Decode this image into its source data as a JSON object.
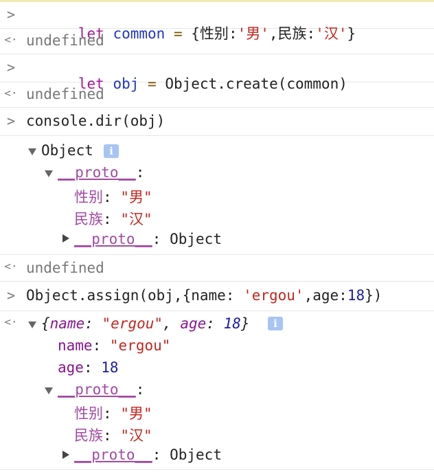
{
  "input_prompt": ">",
  "output_prompt": "<·",
  "lines": {
    "cmd1": {
      "kw": "let",
      "var": "common",
      "op": "=",
      "open": "{",
      "k1": "性别",
      "colon1": ":",
      "v1": "'男'",
      "comma": ",",
      "k2": "民族",
      "colon2": ":",
      "v2": "'汉'",
      "close": "}"
    },
    "out1": "undefined",
    "cmd2": {
      "kw": "let",
      "var": "obj",
      "op": "=",
      "rest": "Object.create(common)"
    },
    "out2": "undefined",
    "cmd3": "console.dir(obj)",
    "dir": {
      "root_label": "Object",
      "info_icon": "i",
      "proto_label": "__proto__",
      "proto_colon": ":",
      "prop1_key": "性别",
      "prop1_value": "\"男\"",
      "prop2_key": "民族",
      "prop2_value": "\"汉\"",
      "proto2_label": "__proto__",
      "proto2_colon": ":",
      "proto2_value": "Object",
      "colon_sep": ":"
    },
    "out3": "undefined",
    "cmd4": {
      "fn": "Object.assign(obj,{name: ",
      "str": "'ergou'",
      "mid": ",age:",
      "num": "18",
      "end": "})"
    },
    "result": {
      "preview_open": "{",
      "preview_k1": "name",
      "preview_sep1": ": ",
      "preview_v1": "\"ergou\"",
      "preview_comma": ", ",
      "preview_k2": "age",
      "preview_sep2": ": ",
      "preview_v2": "18",
      "preview_close": "}",
      "info_icon": "i",
      "name_key": "name",
      "name_value": "\"ergou\"",
      "age_key": "age",
      "age_value": "18",
      "proto_label": "__proto__",
      "proto_colon": ":",
      "prop1_key": "性别",
      "prop1_value": "\"男\"",
      "prop2_key": "民族",
      "prop2_value": "\"汉\"",
      "proto2_label": "__proto__",
      "proto2_colon": ":",
      "proto2_value": "Object",
      "colon_sep": ":"
    }
  }
}
